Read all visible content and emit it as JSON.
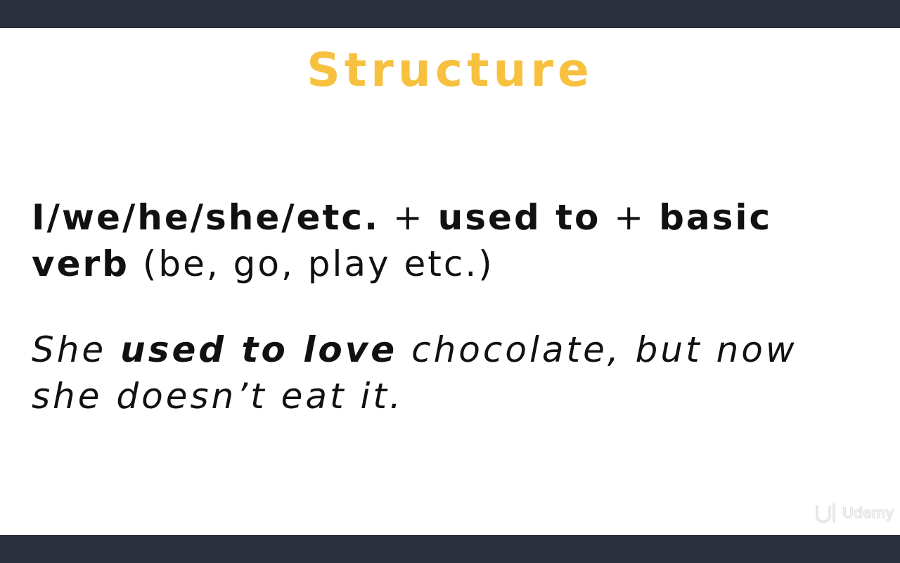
{
  "colors": {
    "frame_bar": "#29303b",
    "slide_bg": "#ffffff",
    "title": "#f7c13f",
    "text": "#111111"
  },
  "slide": {
    "title": "Structure",
    "rule": {
      "subjects": "I/we/he/she/etc.",
      "plus1": " + ",
      "used_to": "used to",
      "plus2": " + ",
      "basic_verb": "basic verb",
      "examples": " (be, go, play etc.)"
    },
    "example": {
      "start": "She ",
      "highlight": "used to love",
      "end": " chocolate, but now she doesn’t eat it."
    }
  },
  "watermark": {
    "brand": "Udemy",
    "icon": "udemy-logo-icon"
  }
}
